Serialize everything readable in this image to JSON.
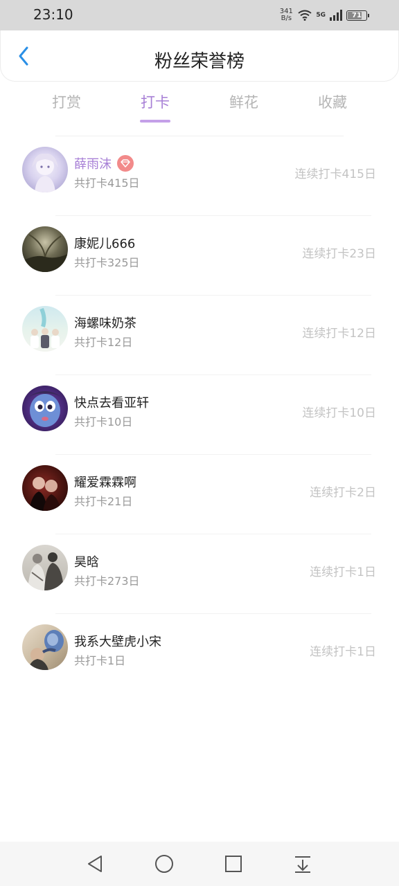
{
  "status_bar": {
    "time": "23:10",
    "net_speed_value": "341",
    "net_speed_unit": "B/s",
    "signal_label": "5G",
    "battery": "71"
  },
  "header": {
    "title": "粉丝荣誉榜",
    "back_icon": "chevron-left-icon"
  },
  "tabs": [
    {
      "label": "打赏",
      "active": false
    },
    {
      "label": "打卡",
      "active": true
    },
    {
      "label": "鲜花",
      "active": false
    },
    {
      "label": "收藏",
      "active": false
    }
  ],
  "colors": {
    "accent": "#a77fd6",
    "badge": "#f28a8a",
    "back_arrow": "#2a8fe6"
  },
  "fans": [
    {
      "name": "薛雨沫",
      "total": "共打卡415日",
      "streak": "连续打卡415日",
      "top": true
    },
    {
      "name": "康妮儿666",
      "total": "共打卡325日",
      "streak": "连续打卡23日",
      "top": false
    },
    {
      "name": "海螺味奶茶",
      "total": "共打卡12日",
      "streak": "连续打卡12日",
      "top": false
    },
    {
      "name": "快点去看亚轩",
      "total": "共打卡10日",
      "streak": "连续打卡10日",
      "top": false
    },
    {
      "name": "耀爱霖霖啊",
      "total": "共打卡21日",
      "streak": "连续打卡2日",
      "top": false
    },
    {
      "name": "昊晗",
      "total": "共打卡273日",
      "streak": "连续打卡1日",
      "top": false
    },
    {
      "name": "我系大壁虎小宋",
      "total": "共打卡1日",
      "streak": "连续打卡1日",
      "top": false
    }
  ],
  "nav": {
    "back": "nav-back-icon",
    "home": "nav-home-icon",
    "recents": "nav-recents-icon",
    "menu": "nav-pulldown-icon"
  }
}
